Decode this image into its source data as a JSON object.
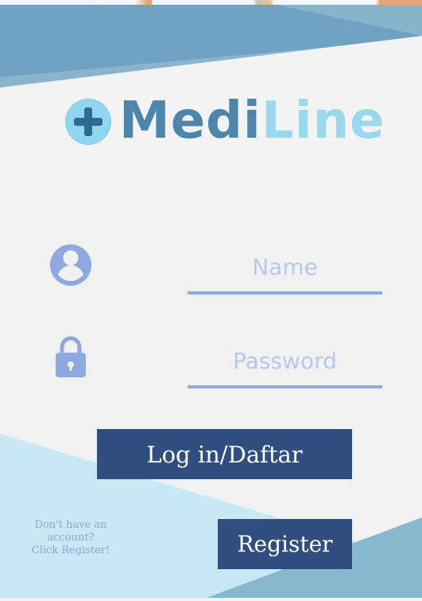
{
  "app": {
    "title": "MediLine",
    "logo": {
      "part1": "Medi",
      "part2": "Line",
      "icon": "medical-plus-icon"
    }
  },
  "form": {
    "name_placeholder": "Name",
    "password_placeholder": "Password",
    "login_label": "Log in/Daftar",
    "register_label": "Register",
    "register_prompt_line1": "Don't have an account?",
    "register_prompt_line2": "Click Register!"
  },
  "icons": {
    "user": "user-icon",
    "lock": "lock-icon"
  },
  "colors": {
    "background": "#f1f1f2",
    "top_band": "#6ea2c0",
    "light_band": "#c7e8f4",
    "accent_blue": "#8ea9df",
    "button_blue": "#304f7e",
    "logo_dark": "#4d86aa",
    "logo_light": "#9ad8ef"
  }
}
